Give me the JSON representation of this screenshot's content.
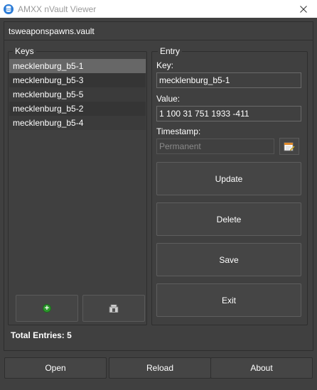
{
  "window": {
    "title": "AMXX nVault Viewer"
  },
  "file": {
    "name": "tsweaponspawns.vault"
  },
  "keys": {
    "title": "Keys",
    "items": [
      {
        "label": "mecklenburg_b5-1"
      },
      {
        "label": "mecklenburg_b5-3"
      },
      {
        "label": "mecklenburg_b5-5"
      },
      {
        "label": "mecklenburg_b5-2"
      },
      {
        "label": "mecklenburg_b5-4"
      }
    ],
    "selected_index": 0
  },
  "entry": {
    "title": "Entry",
    "key_label": "Key:",
    "key_value": "mecklenburg_b5-1",
    "value_label": "Value:",
    "value_value": "1 100 31 751 1933 -411",
    "timestamp_label": "Timestamp:",
    "timestamp_value": "Permanent",
    "buttons": {
      "update": "Update",
      "delete": "Delete",
      "save": "Save",
      "exit": "Exit"
    }
  },
  "status": {
    "total_entries": "Total Entries: 5"
  },
  "footer": {
    "open": "Open",
    "reload": "Reload",
    "about": "About"
  },
  "icons": {
    "app": "database-icon",
    "add": "add-circle-icon",
    "remove": "trash-icon",
    "timestamp": "calendar-edit-icon",
    "close": "close-icon"
  },
  "colors": {
    "background": "#404040",
    "selected_row": "#676767",
    "add_icon": "#2d9a2d"
  }
}
